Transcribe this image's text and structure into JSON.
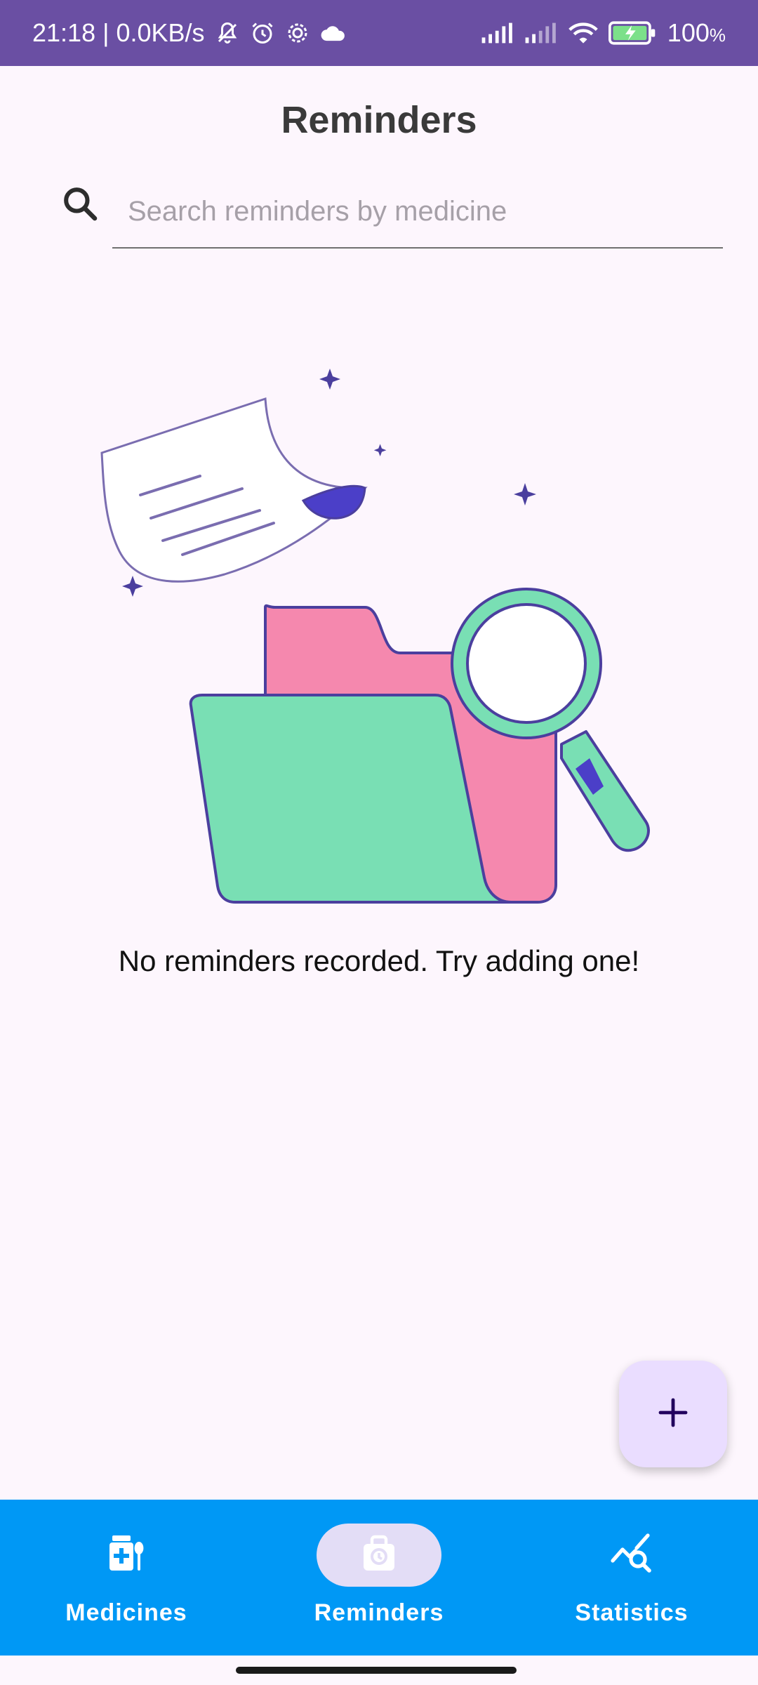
{
  "status_bar": {
    "time_speed": "21:18 | 0.0KB/s",
    "battery": "100",
    "battery_unit": "%",
    "icons": [
      "mute-bell-icon",
      "alarm-icon",
      "settings-icon",
      "cloud-icon",
      "signal-icon",
      "signal-icon",
      "wifi-icon",
      "battery-charging-icon"
    ]
  },
  "header": {
    "title": "Reminders"
  },
  "search": {
    "placeholder": "Search reminders by medicine",
    "value": ""
  },
  "empty_state": {
    "message": "No reminders recorded. Try adding one!",
    "illustration": "folder-document-magnifier-illustration"
  },
  "fab": {
    "icon": "plus-icon"
  },
  "bottom_nav": {
    "items": [
      {
        "label": "Medicines",
        "icon": "medicine-icon",
        "active": false
      },
      {
        "label": "Reminders",
        "icon": "reminder-bag-icon",
        "active": true
      },
      {
        "label": "Statistics",
        "icon": "statistics-icon",
        "active": false
      }
    ]
  },
  "colors": {
    "status_bar": "#6A4FA3",
    "background": "#FDF6FD",
    "nav_background": "#0098F5",
    "fab_background": "#EADDFF",
    "folder_back": "#F588AE",
    "folder_front": "#79DFB4",
    "outline": "#4B3F9E"
  }
}
